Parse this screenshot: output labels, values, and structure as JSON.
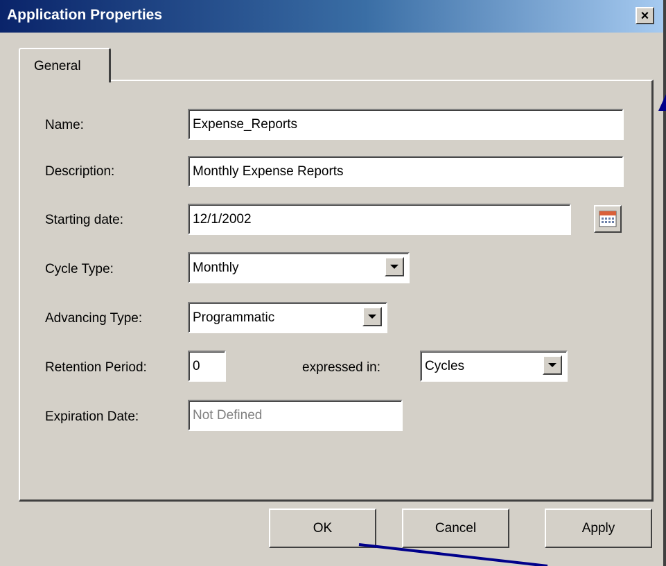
{
  "window": {
    "title": "Application Properties",
    "close_label": "×"
  },
  "tabs": [
    {
      "label": "General",
      "selected": true
    }
  ],
  "form": {
    "name": {
      "label": "Name:",
      "value": "Expense_Reports"
    },
    "description": {
      "label": "Description:",
      "value": "Monthly Expense Reports"
    },
    "starting_date": {
      "label": "Starting date:",
      "value": "12/1/2002",
      "icon": "calendar-icon"
    },
    "cycle_type": {
      "label": "Cycle Type:",
      "value": "Monthly"
    },
    "advancing_type": {
      "label": "Advancing Type:",
      "value": "Programmatic"
    },
    "retention_period": {
      "label": "Retention Period:",
      "value": "0"
    },
    "expressed_in": {
      "label": "expressed in:",
      "value": "Cycles"
    },
    "expiration_date": {
      "label": "Expiration Date:",
      "value": "Not Defined"
    }
  },
  "buttons": {
    "ok": "OK",
    "cancel": "Cancel",
    "apply": "Apply"
  },
  "colors": {
    "title_gradient_start": "#0a246a",
    "title_gradient_end": "#a6caf0",
    "dialog_bg": "#d4d0c8",
    "annotation_arrow": "#00008b"
  }
}
